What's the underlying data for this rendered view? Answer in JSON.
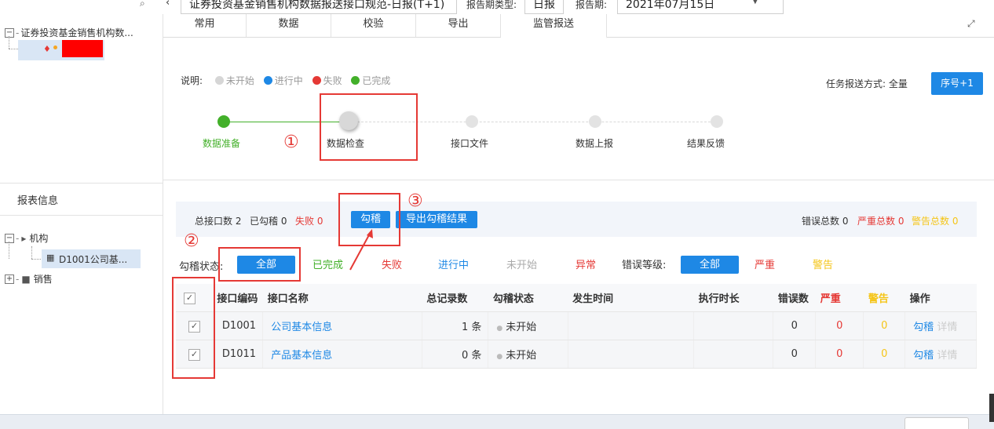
{
  "top": {
    "report_spec": "证券投资基金销售机构数据报送接口规范-日报(T+1)",
    "period_type_label": "报告期类型:",
    "period_type": "日报",
    "period_label": "报告期:",
    "period": "2021年07月15日"
  },
  "left": {
    "tree_root": "证券投资基金销售机构数...",
    "report_info_title": "报表信息",
    "org_label": "机构",
    "org_child": "D1001公司基...",
    "sales_label": "销售"
  },
  "tabs": [
    "常用",
    "数据",
    "校验",
    "导出",
    "监管报送"
  ],
  "legend": {
    "label": "说明:",
    "items": [
      {
        "label": "未开始",
        "color": "#d6d6d6"
      },
      {
        "label": "进行中",
        "color": "#1e88e5"
      },
      {
        "label": "失败",
        "color": "#e53935"
      },
      {
        "label": "已完成",
        "color": "#43b02a"
      }
    ]
  },
  "send_mode_label": "任务报送方式: 全量",
  "seq_button": "序号+1",
  "steps": [
    {
      "label": "数据准备",
      "state": "done"
    },
    {
      "label": "数据检查",
      "state": "current"
    },
    {
      "label": "接口文件",
      "state": "pending"
    },
    {
      "label": "数据上报",
      "state": "pending"
    },
    {
      "label": "结果反馈",
      "state": "pending"
    }
  ],
  "annotations": [
    "①",
    "②",
    "③"
  ],
  "summary": {
    "total": "总接口数 2",
    "checked": "已勾稽 0",
    "failed": "失败 0",
    "check_button": "勾稽",
    "export_button": "导出勾稽结果",
    "error_total": "错误总数 0",
    "serious_total": "严重总数 0",
    "warning_total": "警告总数 0"
  },
  "filters": {
    "status_label": "勾稽状态:",
    "status_options": [
      "全部",
      "已完成",
      "失败",
      "进行中",
      "未开始",
      "异常"
    ],
    "level_label": "错误等级:",
    "level_options": [
      "全部",
      "严重",
      "警告"
    ]
  },
  "table": {
    "headers": [
      "接口编码",
      "接口名称",
      "总记录数",
      "勾稽状态",
      "发生时间",
      "执行时长",
      "错误数",
      "严重",
      "警告",
      "操作"
    ],
    "rows": [
      {
        "code": "D1001",
        "name": "公司基本信息",
        "records": "1 条",
        "status": "未开始",
        "time": "",
        "duration": "",
        "errors": "0",
        "serious": "0",
        "warning": "0",
        "op1": "勾稽",
        "op2": "详情"
      },
      {
        "code": "D1011",
        "name": "产品基本信息",
        "records": "0 条",
        "status": "未开始",
        "time": "",
        "duration": "",
        "errors": "0",
        "serious": "0",
        "warning": "0",
        "op1": "勾稽",
        "op2": "详情"
      }
    ]
  }
}
